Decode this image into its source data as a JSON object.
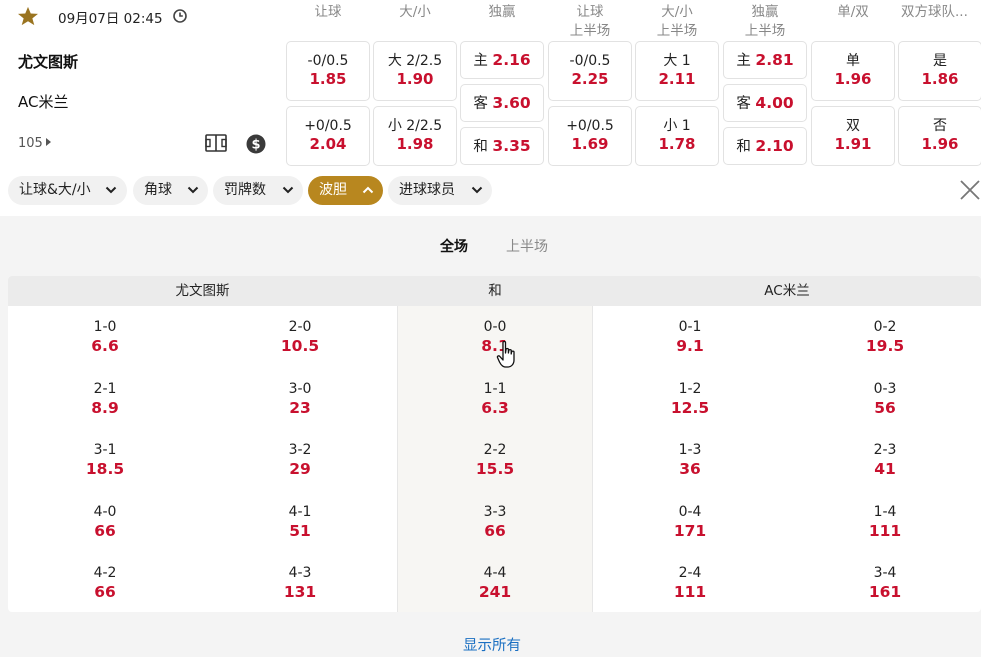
{
  "match": {
    "datetime": "09月07日 02:45",
    "home": "尤文图斯",
    "away": "AC米兰",
    "more_markets": "105",
    "icons": [
      "star-icon",
      "clock-icon",
      "field-stats-icon",
      "dollar-icon"
    ]
  },
  "columns": [
    {
      "line1": "让球",
      "line2": ""
    },
    {
      "line1": "大/小",
      "line2": ""
    },
    {
      "line1": "独赢",
      "line2": ""
    },
    {
      "line1": "让球",
      "line2": "上半场"
    },
    {
      "line1": "大/小",
      "line2": "上半场"
    },
    {
      "line1": "独赢",
      "line2": "上半场"
    },
    {
      "line1": "单/双",
      "line2": ""
    },
    {
      "line1": "双方球队...",
      "line2": ""
    }
  ],
  "odds": {
    "hcap_ft": [
      {
        "label": "-0/0.5",
        "odd": "1.85"
      },
      {
        "label": "+0/0.5",
        "odd": "2.04"
      }
    ],
    "ou_ft": [
      {
        "label": "大 2/2.5",
        "odd": "1.90"
      },
      {
        "label": "小 2/2.5",
        "odd": "1.98"
      }
    ],
    "x12_ft": [
      {
        "label": "主",
        "odd": "2.16"
      },
      {
        "label": "客",
        "odd": "3.60"
      },
      {
        "label": "和",
        "odd": "3.35"
      }
    ],
    "hcap_ht": [
      {
        "label": "-0/0.5",
        "odd": "2.25"
      },
      {
        "label": "+0/0.5",
        "odd": "1.69"
      }
    ],
    "ou_ht": [
      {
        "label": "大 1",
        "odd": "2.11"
      },
      {
        "label": "小 1",
        "odd": "1.78"
      }
    ],
    "x12_ht": [
      {
        "label": "主",
        "odd": "2.81"
      },
      {
        "label": "客",
        "odd": "4.00"
      },
      {
        "label": "和",
        "odd": "2.10"
      }
    ],
    "odd_even": [
      {
        "label": "单",
        "odd": "1.96"
      },
      {
        "label": "双",
        "odd": "1.91"
      }
    ],
    "btts": [
      {
        "label": "是",
        "odd": "1.86"
      },
      {
        "label": "否",
        "odd": "1.96"
      }
    ]
  },
  "chips": [
    {
      "label": "让球&大/小",
      "active": false
    },
    {
      "label": "角球",
      "active": false
    },
    {
      "label": "罚牌数",
      "active": false
    },
    {
      "label": "波胆",
      "active": true
    },
    {
      "label": "进球球员",
      "active": false
    }
  ],
  "period_tabs": {
    "full": "全场",
    "half": "上半场",
    "selected": "全场"
  },
  "score_table": {
    "headers": {
      "home": "尤文图斯",
      "draw": "和",
      "away": "AC米兰"
    },
    "rows": [
      [
        {
          "s": "1-0",
          "o": "6.6"
        },
        {
          "s": "2-0",
          "o": "10.5"
        },
        {
          "s": "0-0",
          "o": "8.1"
        },
        {
          "s": "0-1",
          "o": "9.1"
        },
        {
          "s": "0-2",
          "o": "19.5"
        }
      ],
      [
        {
          "s": "2-1",
          "o": "8.9"
        },
        {
          "s": "3-0",
          "o": "23"
        },
        {
          "s": "1-1",
          "o": "6.3"
        },
        {
          "s": "1-2",
          "o": "12.5"
        },
        {
          "s": "0-3",
          "o": "56"
        }
      ],
      [
        {
          "s": "3-1",
          "o": "18.5"
        },
        {
          "s": "3-2",
          "o": "29"
        },
        {
          "s": "2-2",
          "o": "15.5"
        },
        {
          "s": "1-3",
          "o": "36"
        },
        {
          "s": "2-3",
          "o": "41"
        }
      ],
      [
        {
          "s": "4-0",
          "o": "66"
        },
        {
          "s": "4-1",
          "o": "51"
        },
        {
          "s": "3-3",
          "o": "66"
        },
        {
          "s": "0-4",
          "o": "171"
        },
        {
          "s": "1-4",
          "o": "111"
        }
      ],
      [
        {
          "s": "4-2",
          "o": "66"
        },
        {
          "s": "4-3",
          "o": "131"
        },
        {
          "s": "4-4",
          "o": "241"
        },
        {
          "s": "2-4",
          "o": "111"
        },
        {
          "s": "3-4",
          "o": "161"
        }
      ]
    ]
  },
  "show_all": "显示所有",
  "colors": {
    "odd_red": "#c8102e",
    "gold": "#b8871f",
    "link_blue": "#1a6fc2"
  }
}
